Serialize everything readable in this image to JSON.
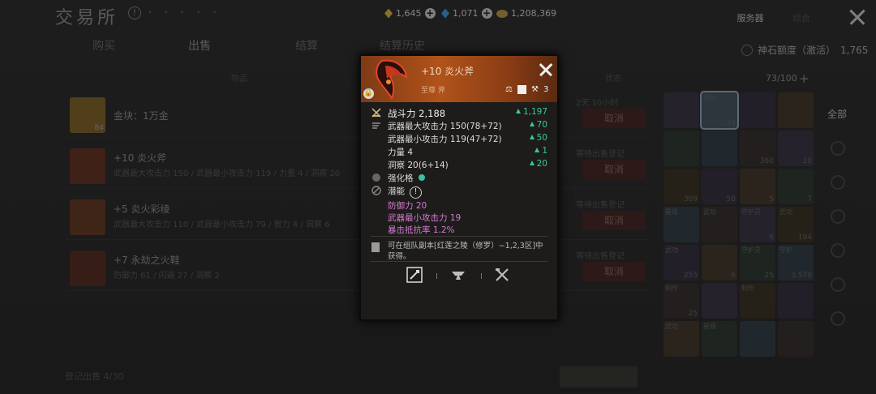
{
  "header": {
    "title": "交易所",
    "currencies": [
      {
        "icon": "yellow-crystal-icon",
        "value": "1,645",
        "color": "#e9c43a"
      },
      {
        "icon": "blue-crystal-icon",
        "value": "1,071",
        "color": "#3fa9e8"
      },
      {
        "icon": "gold-coin-icon",
        "value": "1,208,369",
        "color": "#c8a24a"
      }
    ],
    "server_tab": "服务器",
    "all_tab": "综合"
  },
  "tabs": [
    "购买",
    "出售",
    "结算",
    "结算历史"
  ],
  "quota": {
    "label": "神石额度（激活）",
    "value": "1,765"
  },
  "columns": {
    "item": "物品",
    "state": "状态"
  },
  "inventory": {
    "count": "73/100",
    "plus": "+"
  },
  "listings": [
    {
      "name": "金块：1万金",
      "stats": "",
      "count": "84",
      "status": "2天 10小时",
      "cancel": "取消",
      "color": "#8a6a2a"
    },
    {
      "name": "+10 炎火斧",
      "stats": "武器最大攻击力 150 / 武器最小攻击力 119 / 力量 4 / 洞察 20",
      "count": "",
      "status": "等待出售登记",
      "cancel": "取消",
      "color": "#6a3423"
    },
    {
      "name": "+5 炎火彩绫",
      "stats": "武器最大攻击力 110 / 武器最小攻击力 79 / 智力 4 / 洞察 6",
      "count": "",
      "status": "等待出售登记",
      "cancel": "取消",
      "color": "#6b3a24"
    },
    {
      "name": "+7 永劫之火鞋",
      "stats": "防御力 61 / 闪避 27 / 洞察 2",
      "count": "",
      "status": "等待出售登记",
      "cancel": "取消",
      "color": "#5a2e22"
    }
  ],
  "footer": {
    "label": "登记出售 4/30"
  },
  "side": {
    "all": "全部"
  },
  "grid_cells": [
    {
      "tag": "",
      "n": ""
    },
    {
      "tag": "强化",
      "n": "34"
    },
    {
      "tag": "",
      "n": ""
    },
    {
      "tag": "",
      "n": ""
    },
    {
      "tag": "",
      "n": ""
    },
    {
      "tag": "",
      "n": ""
    },
    {
      "tag": "",
      "n": "360"
    },
    {
      "tag": "",
      "n": "10"
    },
    {
      "tag": "",
      "n": "309"
    },
    {
      "tag": "",
      "n": "50"
    },
    {
      "tag": "",
      "n": "5"
    },
    {
      "tag": "",
      "n": "7"
    },
    {
      "tag": "星级",
      "n": ""
    },
    {
      "tag": "武功",
      "n": ""
    },
    {
      "tag": "守护灵",
      "n": "6"
    },
    {
      "tag": "武功",
      "n": "194"
    },
    {
      "tag": "武功",
      "n": "255"
    },
    {
      "tag": "",
      "n": "6"
    },
    {
      "tag": "守护灵",
      "n": "25"
    },
    {
      "tag": "守护",
      "n": "3,570"
    },
    {
      "tag": "制作",
      "n": "25"
    },
    {
      "tag": "",
      "n": ""
    },
    {
      "tag": "制作",
      "n": ""
    },
    {
      "tag": "",
      "n": ""
    },
    {
      "tag": "武功",
      "n": ""
    },
    {
      "tag": "星级",
      "n": ""
    },
    {
      "tag": "",
      "n": ""
    },
    {
      "tag": "",
      "n": ""
    }
  ],
  "tooltip": {
    "name": "+10 炎火斧",
    "grade": "至尊 斧",
    "bind_count": "3",
    "power": {
      "label": "战斗力 2,188",
      "delta": "1,197"
    },
    "stats": [
      {
        "label": "武器最大攻击力 150(78+72)",
        "delta": "70"
      },
      {
        "label": "武器最小攻击力 119(47+72)",
        "delta": "50"
      },
      {
        "label": "力量 4",
        "delta": "1"
      },
      {
        "label": "洞察 20(6+14)",
        "delta": "20"
      }
    ],
    "enhance_label": "强化格",
    "potential_label": "潜能",
    "potential_mark": "!",
    "potentials": [
      "防御力 20",
      "武器最小攻击力 19",
      "暴击抵抗率 1.2%"
    ],
    "source": "可在组队副本[红莲之陵（修罗）−1,2,3区]中获得。",
    "colors": {
      "header": "#b1531a",
      "positive": "#39c98f",
      "potential": "#d67ad0"
    }
  }
}
